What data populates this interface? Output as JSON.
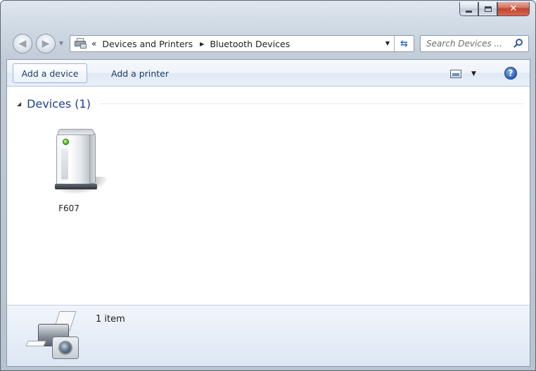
{
  "window": {
    "caption": {
      "minimize_icon": "minimize-icon",
      "maximize_icon": "maximize-icon",
      "close_glyph": "✕"
    },
    "colors": {
      "title_accent": "#1e3f8f",
      "close_button": "#c4432e"
    }
  },
  "navigation": {
    "back_glyph": "◀",
    "forward_glyph": "▶",
    "address": {
      "overflow_glyph": "«",
      "breadcrumbs": [
        "Devices and Printers",
        "Bluetooth Devices"
      ],
      "separator_glyph": "▶",
      "dropdown_glyph": "▼"
    },
    "refresh_glyph": "⇆",
    "search": {
      "placeholder": "Search Devices ..."
    }
  },
  "commandbar": {
    "add_device_label": "Add a device",
    "add_printer_label": "Add a printer",
    "view_dropdown_glyph": "▼",
    "help_glyph": "?"
  },
  "content": {
    "group": {
      "collapse_glyph": "◢",
      "title": "Devices (1)"
    },
    "devices": [
      {
        "label": "F607",
        "icon": "computer-tower-icon"
      }
    ]
  },
  "details": {
    "item_count": "1 item",
    "icon": "devices-and-printers-icon"
  }
}
